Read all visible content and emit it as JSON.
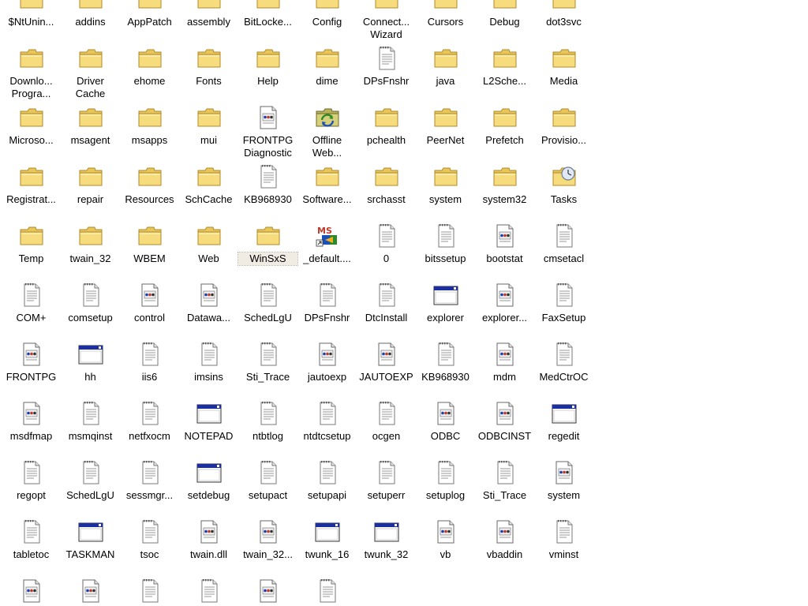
{
  "window": {
    "background": "#ffffff",
    "selected_item": "WinSxS"
  },
  "rows": [
    [
      {
        "label": "$NtUnin...",
        "icon": "folder-icon"
      },
      {
        "label": "addins",
        "icon": "folder-icon"
      },
      {
        "label": "AppPatch",
        "icon": "folder-icon"
      },
      {
        "label": "assembly",
        "icon": "folder-icon"
      },
      {
        "label": "BitLocke...",
        "icon": "folder-icon"
      },
      {
        "label": "Config",
        "icon": "folder-icon"
      },
      {
        "label": "Connect... Wizard",
        "icon": "folder-icon"
      },
      {
        "label": "Cursors",
        "icon": "folder-icon"
      },
      {
        "label": "Debug",
        "icon": "folder-icon"
      },
      {
        "label": "dot3svc",
        "icon": "folder-icon"
      }
    ],
    [
      {
        "label": "Downlo... Progra...",
        "icon": "folder-icon"
      },
      {
        "label": "Driver Cache",
        "icon": "folder-icon"
      },
      {
        "label": "ehome",
        "icon": "folder-icon"
      },
      {
        "label": "Fonts",
        "icon": "folder-icon"
      },
      {
        "label": "Help",
        "icon": "folder-icon"
      },
      {
        "label": "dime",
        "icon": "folder-icon"
      },
      {
        "label": "DPsFnshr",
        "icon": "text-file-icon"
      },
      {
        "label": "java",
        "icon": "folder-icon"
      },
      {
        "label": "L2Sche...",
        "icon": "folder-icon"
      },
      {
        "label": "Media",
        "icon": "folder-icon"
      }
    ],
    [
      {
        "label": "Microso...",
        "icon": "folder-icon"
      },
      {
        "label": "msagent",
        "icon": "folder-icon"
      },
      {
        "label": "msapps",
        "icon": "folder-icon"
      },
      {
        "label": "mui",
        "icon": "folder-icon"
      },
      {
        "label": "FRONTPG Diagnostic",
        "icon": "document-icon"
      },
      {
        "label": "Offline Web...",
        "icon": "offline-web-folder-icon"
      },
      {
        "label": "pchealth",
        "icon": "folder-icon"
      },
      {
        "label": "PeerNet",
        "icon": "folder-icon"
      },
      {
        "label": "Prefetch",
        "icon": "folder-icon"
      },
      {
        "label": "Provisio...",
        "icon": "folder-icon"
      }
    ],
    [
      {
        "label": "Registrat...",
        "icon": "folder-icon"
      },
      {
        "label": "repair",
        "icon": "folder-icon"
      },
      {
        "label": "Resources",
        "icon": "folder-icon"
      },
      {
        "label": "SchCache",
        "icon": "folder-icon"
      },
      {
        "label": "KB968930",
        "icon": "text-file-icon"
      },
      {
        "label": "Software...",
        "icon": "folder-icon"
      },
      {
        "label": "srchasst",
        "icon": "folder-icon"
      },
      {
        "label": "system",
        "icon": "folder-icon"
      },
      {
        "label": "system32",
        "icon": "folder-icon"
      },
      {
        "label": "Tasks",
        "icon": "tasks-folder-icon"
      }
    ],
    [
      {
        "label": "Temp",
        "icon": "folder-icon"
      },
      {
        "label": "twain_32",
        "icon": "folder-icon"
      },
      {
        "label": "WBEM",
        "icon": "folder-icon"
      },
      {
        "label": "Web",
        "icon": "folder-icon"
      },
      {
        "label": "WinSxS",
        "icon": "folder-icon"
      },
      {
        "label": "_default....",
        "icon": "msn-shortcut-icon"
      },
      {
        "label": "0",
        "icon": "text-file-icon"
      },
      {
        "label": "bitssetup",
        "icon": "text-file-icon"
      },
      {
        "label": "bootstat",
        "icon": "document-icon"
      },
      {
        "label": "cmsetacl",
        "icon": "text-file-icon"
      }
    ],
    [
      {
        "label": "COM+",
        "icon": "text-file-icon"
      },
      {
        "label": "comsetup",
        "icon": "text-file-icon"
      },
      {
        "label": "control",
        "icon": "document-icon"
      },
      {
        "label": "Datawa...",
        "icon": "document-icon"
      },
      {
        "label": "SchedLgU",
        "icon": "text-file-icon"
      },
      {
        "label": "DPsFnshr",
        "icon": "text-file-icon"
      },
      {
        "label": "DtcInstall",
        "icon": "text-file-icon"
      },
      {
        "label": "explorer",
        "icon": "application-icon"
      },
      {
        "label": "explorer...",
        "icon": "document-icon"
      },
      {
        "label": "FaxSetup",
        "icon": "text-file-icon"
      }
    ],
    [
      {
        "label": "FRONTPG",
        "icon": "document-icon"
      },
      {
        "label": "hh",
        "icon": "application-icon"
      },
      {
        "label": "iis6",
        "icon": "text-file-icon"
      },
      {
        "label": "imsins",
        "icon": "text-file-icon"
      },
      {
        "label": "Sti_Trace",
        "icon": "text-file-icon"
      },
      {
        "label": "jautoexp",
        "icon": "document-icon"
      },
      {
        "label": "JAUTOEXP",
        "icon": "document-icon"
      },
      {
        "label": "KB968930",
        "icon": "text-file-icon"
      },
      {
        "label": "mdm",
        "icon": "document-icon"
      },
      {
        "label": "MedCtrOC",
        "icon": "text-file-icon"
      }
    ],
    [
      {
        "label": "msdfmap",
        "icon": "document-icon"
      },
      {
        "label": "msmqinst",
        "icon": "text-file-icon"
      },
      {
        "label": "netfxocm",
        "icon": "text-file-icon"
      },
      {
        "label": "NOTEPAD",
        "icon": "application-icon"
      },
      {
        "label": "ntbtlog",
        "icon": "text-file-icon"
      },
      {
        "label": "ntdtcsetup",
        "icon": "text-file-icon"
      },
      {
        "label": "ocgen",
        "icon": "text-file-icon"
      },
      {
        "label": "ODBC",
        "icon": "document-icon"
      },
      {
        "label": "ODBCINST",
        "icon": "document-icon"
      },
      {
        "label": "regedit",
        "icon": "application-icon"
      }
    ],
    [
      {
        "label": "regopt",
        "icon": "text-file-icon"
      },
      {
        "label": "SchedLgU",
        "icon": "text-file-icon"
      },
      {
        "label": "sessmgr...",
        "icon": "text-file-icon"
      },
      {
        "label": "setdebug",
        "icon": "application-icon"
      },
      {
        "label": "setupact",
        "icon": "text-file-icon"
      },
      {
        "label": "setupapi",
        "icon": "text-file-icon"
      },
      {
        "label": "setuperr",
        "icon": "text-file-icon"
      },
      {
        "label": "setuplog",
        "icon": "text-file-icon"
      },
      {
        "label": "Sti_Trace",
        "icon": "text-file-icon"
      },
      {
        "label": "system",
        "icon": "document-icon"
      }
    ],
    [
      {
        "label": "tabletoc",
        "icon": "text-file-icon"
      },
      {
        "label": "TASKMAN",
        "icon": "application-icon"
      },
      {
        "label": "tsoc",
        "icon": "text-file-icon"
      },
      {
        "label": "twain.dll",
        "icon": "document-icon"
      },
      {
        "label": "twain_32...",
        "icon": "document-icon"
      },
      {
        "label": "twunk_16",
        "icon": "application-icon"
      },
      {
        "label": "twunk_32",
        "icon": "application-icon"
      },
      {
        "label": "vb",
        "icon": "document-icon"
      },
      {
        "label": "vbaddin",
        "icon": "document-icon"
      },
      {
        "label": "vminst",
        "icon": "text-file-icon"
      }
    ],
    [
      {
        "label": "",
        "icon": "document-icon"
      },
      {
        "label": "",
        "icon": "document-icon"
      },
      {
        "label": "",
        "icon": "text-file-icon"
      },
      {
        "label": "",
        "icon": "text-file-icon"
      },
      {
        "label": "",
        "icon": "document-icon"
      },
      {
        "label": "",
        "icon": "text-file-icon"
      }
    ]
  ]
}
